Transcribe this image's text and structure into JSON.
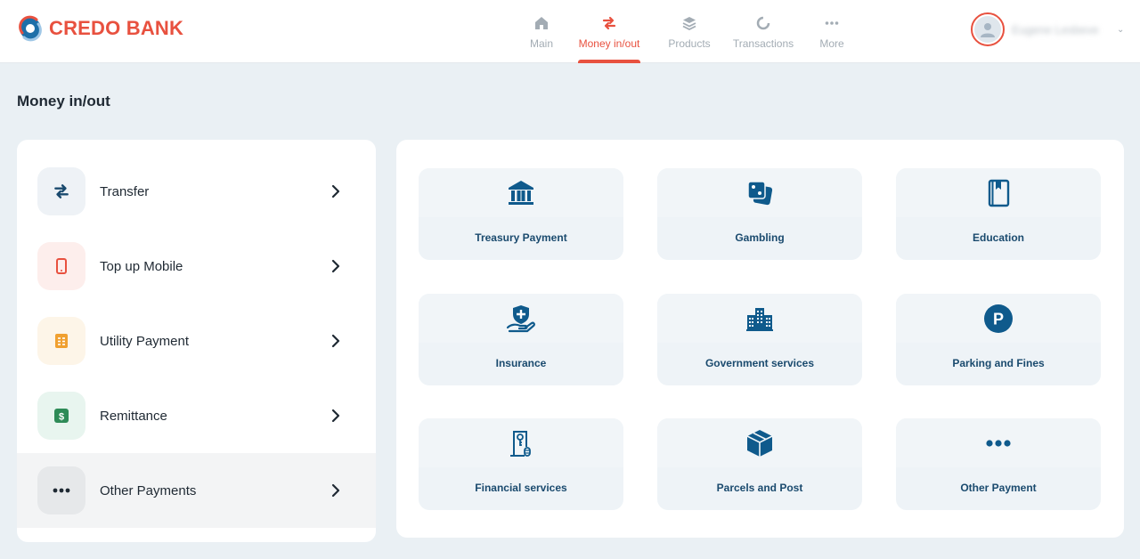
{
  "brand": {
    "name": "CREDO BANK",
    "accent": "#e8513f",
    "tile_icon_color": "#0f5a8c"
  },
  "nav": {
    "items": [
      {
        "label": "Main",
        "icon": "home-icon"
      },
      {
        "label": "Money in/out",
        "icon": "transfer-arrows-icon",
        "active": true
      },
      {
        "label": "Products",
        "icon": "layers-icon"
      },
      {
        "label": "Transactions",
        "icon": "pie-chart-icon"
      },
      {
        "label": "More",
        "icon": "more-dots-icon"
      }
    ]
  },
  "user": {
    "name": "Eugene Lesbeve"
  },
  "page": {
    "title": "Money in/out"
  },
  "menu": {
    "items": [
      {
        "label": "Transfer",
        "icon": "transfer-arrows-icon",
        "bg": "#eef2f6",
        "color": "#1a4a6e"
      },
      {
        "label": "Top up Mobile",
        "icon": "mobile-phone-icon",
        "bg": "#fdeeec",
        "color": "#e8513f"
      },
      {
        "label": "Utility Payment",
        "icon": "utility-bill-icon",
        "bg": "#fdf5e8",
        "color": "#f0a030"
      },
      {
        "label": "Remittance",
        "icon": "dollar-bill-icon",
        "bg": "#e8f5ef",
        "color": "#2e8b57"
      },
      {
        "label": "Other Payments",
        "icon": "more-dots-icon",
        "bg": "#e6e8ea",
        "color": "#1f2933",
        "selected": true
      }
    ]
  },
  "services": {
    "items": [
      {
        "label": "Treasury Payment",
        "icon": "bank-building-icon"
      },
      {
        "label": "Gambling",
        "icon": "dice-icon"
      },
      {
        "label": "Education",
        "icon": "book-icon"
      },
      {
        "label": "Insurance",
        "icon": "insurance-hand-shield-icon"
      },
      {
        "label": "Government services",
        "icon": "government-building-icon"
      },
      {
        "label": "Parking and Fines",
        "icon": "parking-icon"
      },
      {
        "label": "Financial services",
        "icon": "financial-document-icon"
      },
      {
        "label": "Parcels and Post",
        "icon": "parcel-box-icon"
      },
      {
        "label": "Other Payment",
        "icon": "more-dots-icon"
      }
    ]
  }
}
